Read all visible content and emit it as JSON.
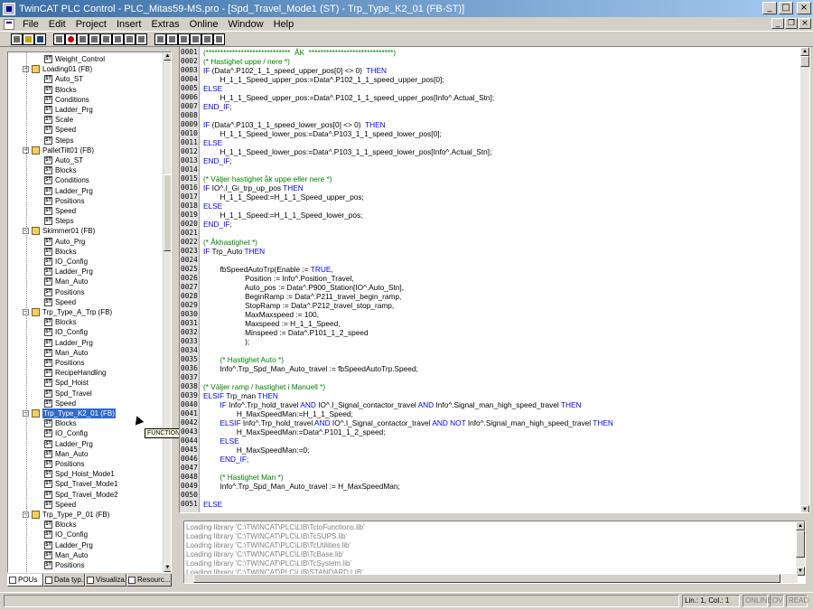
{
  "window": {
    "title": "TwinCAT PLC Control - PLC_Mitas59-MS.pro - [Spd_Travel_Mode1 (ST) - Trp_Type_K2_01 (FB-ST)]"
  },
  "menu": [
    "File",
    "Edit",
    "Project",
    "Insert",
    "Extras",
    "Online",
    "Window",
    "Help"
  ],
  "tree": [
    {
      "label": "Weight_Control",
      "level": 2,
      "kind": "doc"
    },
    {
      "label": "Loading01 (FB)",
      "level": 1,
      "kind": "folder"
    },
    {
      "label": "Auto_ST",
      "level": 2,
      "kind": "doc"
    },
    {
      "label": "Blocks",
      "level": 2,
      "kind": "doc"
    },
    {
      "label": "Conditions",
      "level": 2,
      "kind": "doc"
    },
    {
      "label": "Ladder_Prg",
      "level": 2,
      "kind": "doc"
    },
    {
      "label": "Scale",
      "level": 2,
      "kind": "doc"
    },
    {
      "label": "Speed",
      "level": 2,
      "kind": "doc"
    },
    {
      "label": "Steps",
      "level": 2,
      "kind": "doc"
    },
    {
      "label": "PalletTilt01 (FB)",
      "level": 1,
      "kind": "folder"
    },
    {
      "label": "Auto_ST",
      "level": 2,
      "kind": "doc"
    },
    {
      "label": "Blocks",
      "level": 2,
      "kind": "doc"
    },
    {
      "label": "Conditions",
      "level": 2,
      "kind": "doc"
    },
    {
      "label": "Ladder_Prg",
      "level": 2,
      "kind": "doc"
    },
    {
      "label": "Positions",
      "level": 2,
      "kind": "doc"
    },
    {
      "label": "Speed",
      "level": 2,
      "kind": "doc"
    },
    {
      "label": "Steps",
      "level": 2,
      "kind": "doc"
    },
    {
      "label": "Skimmer01 (FB)",
      "level": 1,
      "kind": "folder"
    },
    {
      "label": "Auto_Prg",
      "level": 2,
      "kind": "doc"
    },
    {
      "label": "Blocks",
      "level": 2,
      "kind": "doc"
    },
    {
      "label": "IO_Config",
      "level": 2,
      "kind": "doc"
    },
    {
      "label": "Ladder_Prg",
      "level": 2,
      "kind": "doc"
    },
    {
      "label": "Man_Auto",
      "level": 2,
      "kind": "doc"
    },
    {
      "label": "Positions",
      "level": 2,
      "kind": "doc"
    },
    {
      "label": "Speed",
      "level": 2,
      "kind": "doc"
    },
    {
      "label": "Trp_Type_A_Trp (FB)",
      "level": 1,
      "kind": "folder"
    },
    {
      "label": "Blocks",
      "level": 2,
      "kind": "doc"
    },
    {
      "label": "IO_Config",
      "level": 2,
      "kind": "doc"
    },
    {
      "label": "Ladder_Prg",
      "level": 2,
      "kind": "doc"
    },
    {
      "label": "Man_Auto",
      "level": 2,
      "kind": "doc"
    },
    {
      "label": "Positions",
      "level": 2,
      "kind": "doc"
    },
    {
      "label": "RecipeHandling",
      "level": 2,
      "kind": "doc"
    },
    {
      "label": "Spd_Hoist",
      "level": 2,
      "kind": "doc"
    },
    {
      "label": "Spd_Travel",
      "level": 2,
      "kind": "doc"
    },
    {
      "label": "Speed",
      "level": 2,
      "kind": "doc"
    },
    {
      "label": "Trp_Type_K2_01 (FB)",
      "level": 1,
      "kind": "folder",
      "selected": true
    },
    {
      "label": "Blocks",
      "level": 2,
      "kind": "doc"
    },
    {
      "label": "IO_Config",
      "level": 2,
      "kind": "doc"
    },
    {
      "label": "Ladder_Prg",
      "level": 2,
      "kind": "doc"
    },
    {
      "label": "Man_Auto",
      "level": 2,
      "kind": "doc"
    },
    {
      "label": "Positions",
      "level": 2,
      "kind": "doc"
    },
    {
      "label": "Spd_Hoist_Mode1",
      "level": 2,
      "kind": "doc"
    },
    {
      "label": "Spd_Travel_Mode1",
      "level": 2,
      "kind": "doc"
    },
    {
      "label": "Spd_Travel_Mode2",
      "level": 2,
      "kind": "doc"
    },
    {
      "label": "Speed",
      "level": 2,
      "kind": "doc"
    },
    {
      "label": "Trp_Type_P_01 (FB)",
      "level": 1,
      "kind": "folder"
    },
    {
      "label": "Blocks",
      "level": 2,
      "kind": "doc"
    },
    {
      "label": "IO_Config",
      "level": 2,
      "kind": "doc"
    },
    {
      "label": "Ladder_Prg",
      "level": 2,
      "kind": "doc"
    },
    {
      "label": "Man_Auto",
      "level": 2,
      "kind": "doc"
    },
    {
      "label": "Positions",
      "level": 2,
      "kind": "doc"
    }
  ],
  "tooltip": "FUNCTION_BLOCK",
  "tabs": [
    "POUs",
    "Data typ...",
    "Visualiza...",
    "Resourc..."
  ],
  "code": [
    {
      "n": "0001",
      "t": [
        [
          "cm",
          "(*****************************  ÅK  *****************************)"
        ]
      ]
    },
    {
      "n": "0002",
      "t": [
        [
          "cm",
          "(* Hastighet uppe / nere *)"
        ]
      ]
    },
    {
      "n": "0003",
      "t": [
        [
          "kw",
          "IF"
        ],
        [
          "",
          " (Data^.P102_1_1_speed_upper_pos[0] <> 0)  "
        ],
        [
          "kw",
          "THEN"
        ]
      ]
    },
    {
      "n": "0004",
      "t": [
        [
          "",
          "        H_1_1_Speed_upper_pos:=Data^.P102_1_1_speed_upper_pos[0];"
        ]
      ]
    },
    {
      "n": "0005",
      "t": [
        [
          "kw",
          "ELSE"
        ]
      ]
    },
    {
      "n": "0006",
      "t": [
        [
          "",
          "        H_1_1_Speed_upper_pos:=Data^.P102_1_1_speed_upper_pos[Info^.Actual_Stn];"
        ]
      ]
    },
    {
      "n": "0007",
      "t": [
        [
          "kw",
          "END_IF"
        ],
        [
          "",
          ";"
        ]
      ]
    },
    {
      "n": "0008",
      "t": []
    },
    {
      "n": "0009",
      "t": [
        [
          "kw",
          "IF"
        ],
        [
          "",
          " (Data^.P103_1_1_speed_lower_pos[0] <> 0)  "
        ],
        [
          "kw",
          "THEN"
        ]
      ]
    },
    {
      "n": "0010",
      "t": [
        [
          "",
          "        H_1_1_Speed_lower_pos:=Data^.P103_1_1_speed_lower_pos[0];"
        ]
      ]
    },
    {
      "n": "0011",
      "t": [
        [
          "kw",
          "ELSE"
        ]
      ]
    },
    {
      "n": "0012",
      "t": [
        [
          "",
          "        H_1_1_Speed_lower_pos:=Data^.P103_1_1_speed_lower_pos[Info^.Actual_Stn];"
        ]
      ]
    },
    {
      "n": "0013",
      "t": [
        [
          "kw",
          "END_IF"
        ],
        [
          "",
          ";"
        ]
      ]
    },
    {
      "n": "0014",
      "t": []
    },
    {
      "n": "0015",
      "t": [
        [
          "cm",
          "(* Väljer hastighet åk uppe eller nere *)"
        ]
      ]
    },
    {
      "n": "0016",
      "t": [
        [
          "kw",
          "IF"
        ],
        [
          "",
          " IO^.I_Gi_trp_up_pos "
        ],
        [
          "kw",
          "THEN"
        ]
      ]
    },
    {
      "n": "0017",
      "t": [
        [
          "",
          "        H_1_1_Speed:=H_1_1_Speed_upper_pos;"
        ]
      ]
    },
    {
      "n": "0018",
      "t": [
        [
          "kw",
          "ELSE"
        ]
      ]
    },
    {
      "n": "0019",
      "t": [
        [
          "",
          "        H_1_1_Speed:=H_1_1_Speed_lower_pos;"
        ]
      ]
    },
    {
      "n": "0020",
      "t": [
        [
          "kw",
          "END_IF"
        ],
        [
          "",
          ";"
        ]
      ]
    },
    {
      "n": "0021",
      "t": []
    },
    {
      "n": "0022",
      "t": [
        [
          "cm",
          "(* Åkhastighet *)"
        ]
      ]
    },
    {
      "n": "0023",
      "t": [
        [
          "kw",
          "IF"
        ],
        [
          "",
          " Trp_Auto "
        ],
        [
          "kw",
          "THEN"
        ]
      ]
    },
    {
      "n": "0024",
      "t": []
    },
    {
      "n": "0025",
      "t": [
        [
          "",
          "        fbSpeedAutoTrp(Enable := "
        ],
        [
          "kw",
          "TRUE"
        ],
        [
          "",
          ","
        ]
      ]
    },
    {
      "n": "0026",
      "t": [
        [
          "",
          "                    Position := Info^.Position_Travel,"
        ]
      ]
    },
    {
      "n": "0027",
      "t": [
        [
          "",
          "                    Auto_pos := Data^.P900_Station[IO^.Auto_Stn],"
        ]
      ]
    },
    {
      "n": "0028",
      "t": [
        [
          "",
          "                    BeginRamp := Data^.P211_travel_begin_ramp,"
        ]
      ]
    },
    {
      "n": "0029",
      "t": [
        [
          "",
          "                    StopRamp := Data^.P212_travel_stop_ramp,"
        ]
      ]
    },
    {
      "n": "0030",
      "t": [
        [
          "",
          "                    MaxMaxspeed := 100,"
        ]
      ]
    },
    {
      "n": "0031",
      "t": [
        [
          "",
          "                    Maxspeed := H_1_1_Speed,"
        ]
      ]
    },
    {
      "n": "0032",
      "t": [
        [
          "",
          "                    Minspeed := Data^.P101_1_2_speed"
        ]
      ]
    },
    {
      "n": "0033",
      "t": [
        [
          "",
          "                    );"
        ]
      ]
    },
    {
      "n": "0034",
      "t": []
    },
    {
      "n": "0035",
      "t": [
        [
          "",
          "        "
        ],
        [
          "cm",
          "(* Hastighet Auto *)"
        ]
      ]
    },
    {
      "n": "0036",
      "t": [
        [
          "",
          "        Info^.Trp_Spd_Man_Auto_travel := fbSpeedAutoTrp.Speed;"
        ]
      ]
    },
    {
      "n": "0037",
      "t": []
    },
    {
      "n": "0038",
      "t": [
        [
          "cm",
          "(* Väljer ramp / hastighet i Manuell *)"
        ]
      ]
    },
    {
      "n": "0039",
      "t": [
        [
          "kw",
          "ELSIF"
        ],
        [
          "",
          " Trp_man "
        ],
        [
          "kw",
          "THEN"
        ]
      ]
    },
    {
      "n": "0040",
      "t": [
        [
          "",
          "        "
        ],
        [
          "kw",
          "IF"
        ],
        [
          "",
          " Info^.Trp_hold_travel "
        ],
        [
          "kw",
          "AND"
        ],
        [
          "",
          " IO^.I_Signal_contactor_travel "
        ],
        [
          "kw",
          "AND"
        ],
        [
          "",
          " Info^.Signal_man_high_speed_travel "
        ],
        [
          "kw",
          "THEN"
        ]
      ]
    },
    {
      "n": "0041",
      "t": [
        [
          "",
          "                H_MaxSpeedMan:=H_1_1_Speed;"
        ]
      ]
    },
    {
      "n": "0042",
      "t": [
        [
          "",
          "        "
        ],
        [
          "kw",
          "ELSIF"
        ],
        [
          "",
          " Info^.Trp_hold_travel "
        ],
        [
          "kw",
          "AND"
        ],
        [
          "",
          " IO^.I_Signal_contactor_travel "
        ],
        [
          "kw",
          "AND NOT"
        ],
        [
          "",
          " Info^.Signal_man_high_speed_travel "
        ],
        [
          "kw",
          "THEN"
        ]
      ]
    },
    {
      "n": "0043",
      "t": [
        [
          "",
          "                H_MaxSpeedMan:=Data^.P101_1_2_speed;"
        ]
      ]
    },
    {
      "n": "0044",
      "t": [
        [
          "",
          "        "
        ],
        [
          "kw",
          "ELSE"
        ]
      ]
    },
    {
      "n": "0045",
      "t": [
        [
          "",
          "                H_MaxSpeedMan:=0;"
        ]
      ]
    },
    {
      "n": "0046",
      "t": [
        [
          "",
          "        "
        ],
        [
          "kw",
          "END_IF"
        ],
        [
          "",
          ";"
        ]
      ]
    },
    {
      "n": "0047",
      "t": []
    },
    {
      "n": "0048",
      "t": [
        [
          "",
          "        "
        ],
        [
          "cm",
          "(* Hastighet Man *)"
        ]
      ]
    },
    {
      "n": "0049",
      "t": [
        [
          "",
          "        Info^.Trp_Spd_Man_Auto_travel := H_MaxSpeedMan;"
        ]
      ]
    },
    {
      "n": "0050",
      "t": []
    },
    {
      "n": "0051",
      "t": [
        [
          "kw",
          "ELSE"
        ]
      ]
    }
  ],
  "output": [
    "Loading library 'C:\\TWINCAT\\PLC\\LIB\\TcIoFunctions.lib'",
    "Loading library 'C:\\TWINCAT\\PLC\\LIB\\TcSUPS.lib'",
    "Loading library 'C:\\TWINCAT\\PLC\\LIB\\TcUtilities.lib'",
    "Loading library 'C:\\TWINCAT\\PLC\\LIB\\TcBase.lib'",
    "Loading library 'C:\\TWINCAT\\PLC\\LIB\\TcSystem.lib'",
    "Loading library 'C:\\TWINCAT\\PLC\\LIB\\STANDARD.LIB'"
  ],
  "status": {
    "position": "Lin.: 1, Col.: 1",
    "online": "ONLINE",
    "ov": "OV",
    "read": "READ"
  }
}
